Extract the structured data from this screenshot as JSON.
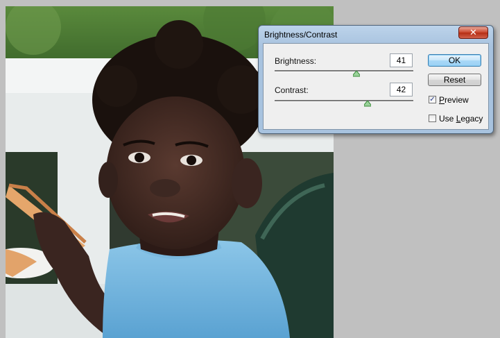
{
  "dialog": {
    "title": "Brightness/Contrast",
    "close_label": "✕",
    "brightness": {
      "label": "Brightness:",
      "value": "41",
      "slider_level": 0.59
    },
    "contrast": {
      "label": "Contrast:",
      "value": "42",
      "slider_level": 0.67
    },
    "ok_label": "OK",
    "reset_label": "Reset",
    "preview": {
      "label_pre": "",
      "label_key": "P",
      "label_post": "review",
      "checked": true,
      "mark": "✓"
    },
    "use_legacy": {
      "label_pre": "Use ",
      "label_key": "L",
      "label_post": "egacy",
      "checked": false
    }
  },
  "colors": {
    "accent": "#a9d8f7",
    "close_red": "#c9432a",
    "slider_thumb": "#3a8a3a"
  }
}
